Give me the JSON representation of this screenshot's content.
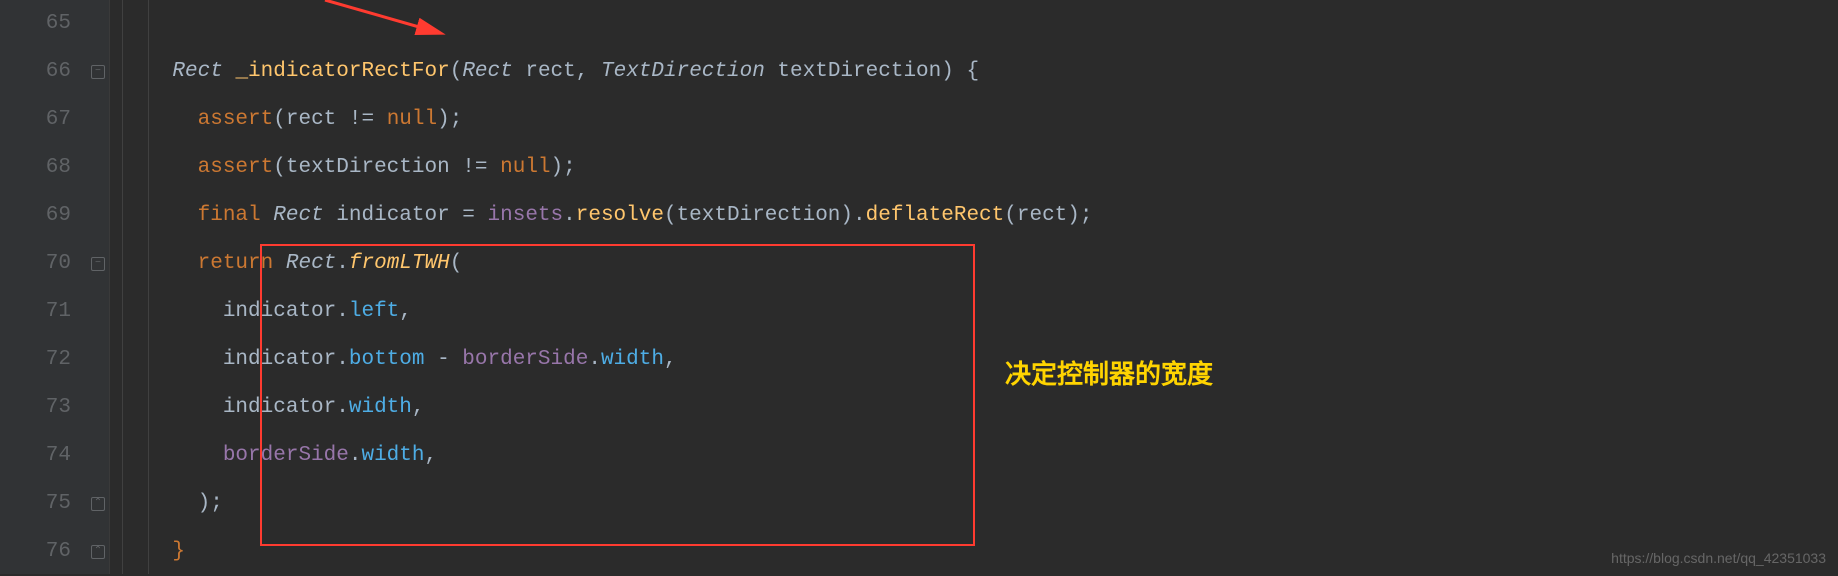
{
  "gutter": {
    "lines": [
      "65",
      "66",
      "67",
      "68",
      "69",
      "70",
      "71",
      "72",
      "73",
      "74",
      "75",
      "76"
    ]
  },
  "code": {
    "l66": {
      "indent": "    ",
      "type1": "Rect",
      "sp1": " ",
      "method": "_indicatorRectFor",
      "open": "(",
      "type2": "Rect",
      "sp2": " ",
      "p1": "rect",
      "comma1": ", ",
      "type3": "TextDirection",
      "sp3": " ",
      "p2": "textDirection",
      "close": ") ",
      "brace": "{"
    },
    "l67": {
      "indent": "      ",
      "kw": "assert",
      "open": "(",
      "var": "rect",
      "op": " != ",
      "null": "null",
      "close": ");"
    },
    "l68": {
      "indent": "      ",
      "kw": "assert",
      "open": "(",
      "var": "textDirection",
      "op": " != ",
      "null": "null",
      "close": ");"
    },
    "l69": {
      "indent": "      ",
      "final": "final",
      "sp1": " ",
      "type": "Rect",
      "sp2": " ",
      "var": "indicator",
      "eq": " = ",
      "f1": "insets",
      "dot1": ".",
      "m1": "resolve",
      "open1": "(",
      "arg1": "textDirection",
      "close1": ").",
      "m2": "deflateRect",
      "open2": "(",
      "arg2": "rect",
      "close2": ");"
    },
    "l70": {
      "indent": "      ",
      "kw": "return",
      "sp": " ",
      "type": "Rect",
      "dot": ".",
      "m": "fromLTWH",
      "open": "("
    },
    "l71": {
      "indent": "        ",
      "var": "indicator",
      "dot": ".",
      "field": "left",
      "comma": ","
    },
    "l72": {
      "indent": "        ",
      "var1": "indicator",
      "dot1": ".",
      "field1": "bottom",
      "op": " - ",
      "var2": "borderSide",
      "dot2": ".",
      "field2": "width",
      "comma": ","
    },
    "l73": {
      "indent": "        ",
      "var": "indicator",
      "dot": ".",
      "field": "width",
      "comma": ","
    },
    "l74": {
      "indent": "        ",
      "var": "borderSide",
      "dot": ".",
      "field": "width",
      "comma": ","
    },
    "l75": {
      "indent": "      ",
      "close": ");"
    },
    "l76": {
      "indent": "    ",
      "brace": "}"
    }
  },
  "annotation": "决定控制器的宽度",
  "watermark": "https://blog.csdn.net/qq_42351033"
}
